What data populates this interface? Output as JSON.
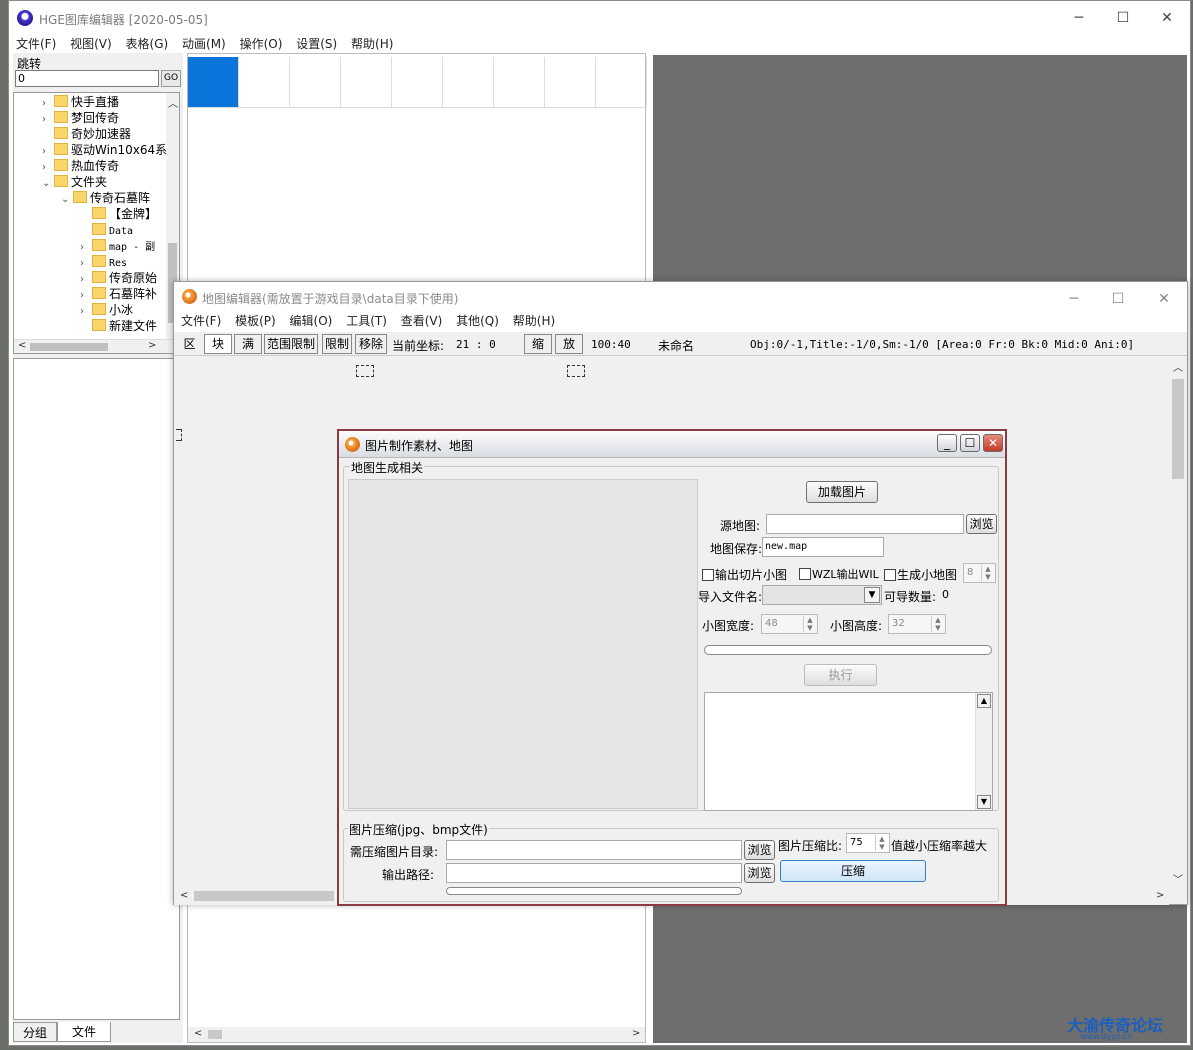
{
  "main": {
    "title": "HGE图库编辑器 [2020-05-05]",
    "menu": [
      "文件(F)",
      "视图(V)",
      "表格(G)",
      "动画(M)",
      "操作(O)",
      "设置(S)",
      "帮助(H)"
    ]
  },
  "left": {
    "jump_label": "跳转",
    "jump_value": "0",
    "go_label": "GO",
    "tree": [
      {
        "label": "快手直播",
        "level": 0,
        "exp": ">"
      },
      {
        "label": "梦回传奇",
        "level": 0,
        "exp": ">"
      },
      {
        "label": "奇妙加速器",
        "level": 0,
        "exp": ""
      },
      {
        "label": "驱动Win10x64系",
        "level": 0,
        "exp": ">"
      },
      {
        "label": "热血传奇",
        "level": 0,
        "exp": ">"
      },
      {
        "label": "文件夹",
        "level": 0,
        "exp": "v"
      },
      {
        "label": "传奇石墓阵",
        "level": 1,
        "exp": "v"
      },
      {
        "label": "【金牌】",
        "level": 2,
        "exp": ""
      },
      {
        "label": "Data",
        "level": 2,
        "exp": "",
        "mono": true
      },
      {
        "label": "map - 副",
        "level": 2,
        "exp": ">",
        "mono": true
      },
      {
        "label": "Res",
        "level": 2,
        "exp": ">",
        "mono": true
      },
      {
        "label": "传奇原始",
        "level": 2,
        "exp": ">"
      },
      {
        "label": "石墓阵补",
        "level": 2,
        "exp": ">"
      },
      {
        "label": "小冰",
        "level": 2,
        "exp": ">"
      },
      {
        "label": "新建文件",
        "level": 2,
        "exp": ""
      }
    ],
    "tabs": [
      "分组",
      "文件"
    ]
  },
  "mapwin": {
    "title": "地图编辑器(需放置于游戏目录\\data目录下使用)",
    "menu": [
      "文件(F)",
      "模板(P)",
      "编辑(O)",
      "工具(T)",
      "查看(V)",
      "其他(Q)",
      "帮助(H)"
    ],
    "toolbar": {
      "qu": "区",
      "kuai": "块",
      "man": "满",
      "range_limit": "范围限制",
      "limit": "限制",
      "move": "移除",
      "coord_label": "当前坐标:",
      "coord_value": "21 : 0",
      "shrink": "缩",
      "zoom": "放",
      "scale": "100:40",
      "name": "未命名",
      "status": "Obj:0/-1,Title:-1/0,Sm:-1/0 [Area:0 Fr:0 Bk:0 Mid:0 Ani:0]"
    }
  },
  "dialog": {
    "title": "图片制作素材、地图",
    "group1": "地图生成相关",
    "load_btn": "加载图片",
    "src_label": "源地图:",
    "browse": "浏览",
    "save_label": "地图保存:",
    "save_value": "new.map",
    "cb_slice": "输出切片小图",
    "cb_wzl": "WZL输出WIL",
    "cb_mini": "生成小地图",
    "mini_value": "8",
    "import_label": "导入文件名:",
    "importable_label": "可导数量:",
    "importable_value": "0",
    "width_label": "小图宽度:",
    "width_value": "48",
    "height_label": "小图高度:",
    "height_value": "32",
    "exec_btn": "执行",
    "group2": "图片压缩(jpg、bmp文件)",
    "compress_dir_label": "需压缩图片目录:",
    "output_label": "输出路径:",
    "ratio_label": "图片压缩比:",
    "ratio_value": "75",
    "ratio_hint": "值越小压缩率越大",
    "compress_btn": "压缩"
  },
  "watermark": {
    "main": "大渝传奇论坛",
    "sub": "www.dyyz.cn"
  }
}
